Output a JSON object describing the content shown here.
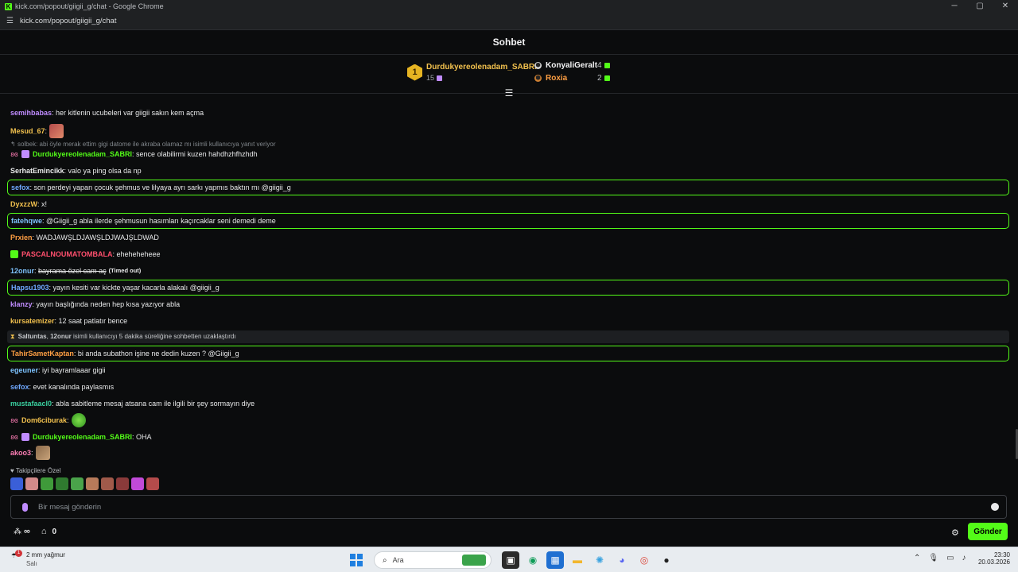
{
  "browser": {
    "title": "kick.com/popout/giigii_g/chat - Google Chrome",
    "url": "kick.com/popout/giigii_g/chat",
    "controls": [
      "─",
      "▢",
      "✕"
    ]
  },
  "chat": {
    "header": "Sohbet",
    "leaderboard": {
      "first": {
        "rank": "1",
        "name": "Durdukyereolenadam_SABRI",
        "count": "15"
      },
      "second": {
        "name": "KonyaliGeralt",
        "count": "4"
      },
      "third": {
        "name": "Roxia",
        "count": "2"
      }
    },
    "messages": [
      {
        "user": "semihbabas",
        "color": "#c08cff",
        "text": ": her kitlenin ucubeleri var giigii sakın kem açma"
      },
      {
        "user": "Mesud_67",
        "color": "#f2c14e",
        "text": ":"
      },
      {
        "reply": "solbek: abi öyle merak ettim gigi datome ile akraba olamaz mı isimli kullanıcıya yanıt veriyor"
      },
      {
        "user": "Durdukyereolenadam_SABRI",
        "color": "#53fc18",
        "text": ": sence olabilirmi kuzen hahdhzhfhzhdh"
      },
      {
        "user": "SerhatEmincikk",
        "color": "#e9eaeb",
        "text": ": valo ya ping olsa da np"
      },
      {
        "user": "sefox",
        "color": "#6fa8ff",
        "text": ": son perdeyi yapan çocuk şehmus ve lilyaya ayrı sarkı yapmıs baktın mı @giigii_g"
      },
      {
        "user": "DyxzzW",
        "color": "#f2c14e",
        "text": ": x!"
      },
      {
        "user": "fatehqwe",
        "color": "#7ec3ff",
        "text": ": @Giigii_g abla ilerde şehmusun hasımları kaçırcaklar seni demedi deme"
      },
      {
        "user": "Prxien",
        "color": "#ff9f43",
        "text": ": WADJAWŞLDJAWŞLDJWAJŞLDWAD"
      },
      {
        "user": "PASCALNOUMATOMBALA",
        "color": "#ff4f6d",
        "text": ": ehehehehеee"
      },
      {
        "user": "12onur",
        "color": "#7ec3ff",
        "text": ":",
        "struck": "bayrama özel cam aç",
        "timed": "(Timed out)"
      },
      {
        "user": "Hapsu1903",
        "color": "#6fa8ff",
        "text": ": yayın kesiti var kickte yaşar kacarla alakalı @giigii_g"
      },
      {
        "user": "klanzy",
        "color": "#c08cff",
        "text": ": yayın başlığında neden hep kısa yazıyor abla"
      },
      {
        "user": "kursatemizer",
        "color": "#f2c14e",
        "text": ": 12 saat patlatır bence"
      },
      {
        "system_user": "Saltuntas",
        "system_target": "12onur",
        "system_text": "isimli kullanıcıyı 5 dakika süreliğine sohbetten uzaklaştırdı"
      },
      {
        "user": "TahirSametKaptan",
        "color": "#ff9f43",
        "text": ": bi anda subathon işine ne dedin kuzen ? @Giigii_g"
      },
      {
        "user": "egeuner",
        "color": "#7ec3ff",
        "text": ": iyi bayramlaaar gigii"
      },
      {
        "user": "sefox",
        "color": "#6fa8ff",
        "text": ": evet kanalında paylasmıs"
      },
      {
        "user": "mustafaacl0",
        "color": "#3ad1a0",
        "text": ": abla sabitleme mesaj atsana cam ile ilgili bir şey sormayın diye"
      },
      {
        "user": "Dom6ciburak",
        "color": "#f2c14e",
        "text": ":"
      },
      {
        "user": "Durdukyereolenadam_SABRI",
        "color": "#53fc18",
        "text": ": OHA"
      },
      {
        "user": "akoo3",
        "color": "#ff7eb6",
        "text": ":"
      }
    ],
    "emote_bar_label": "Takipçilere Özel",
    "input_placeholder": "Bir mesaj gönderin",
    "points": "∞",
    "store_count": "0",
    "send_label": "Gönder"
  },
  "taskbar": {
    "weather_badge": "1",
    "weather_line1": "2 mm yağmur",
    "weather_line2": "Salı",
    "search_placeholder": "Ara",
    "time": "23:30",
    "date": "20.03.2026"
  }
}
